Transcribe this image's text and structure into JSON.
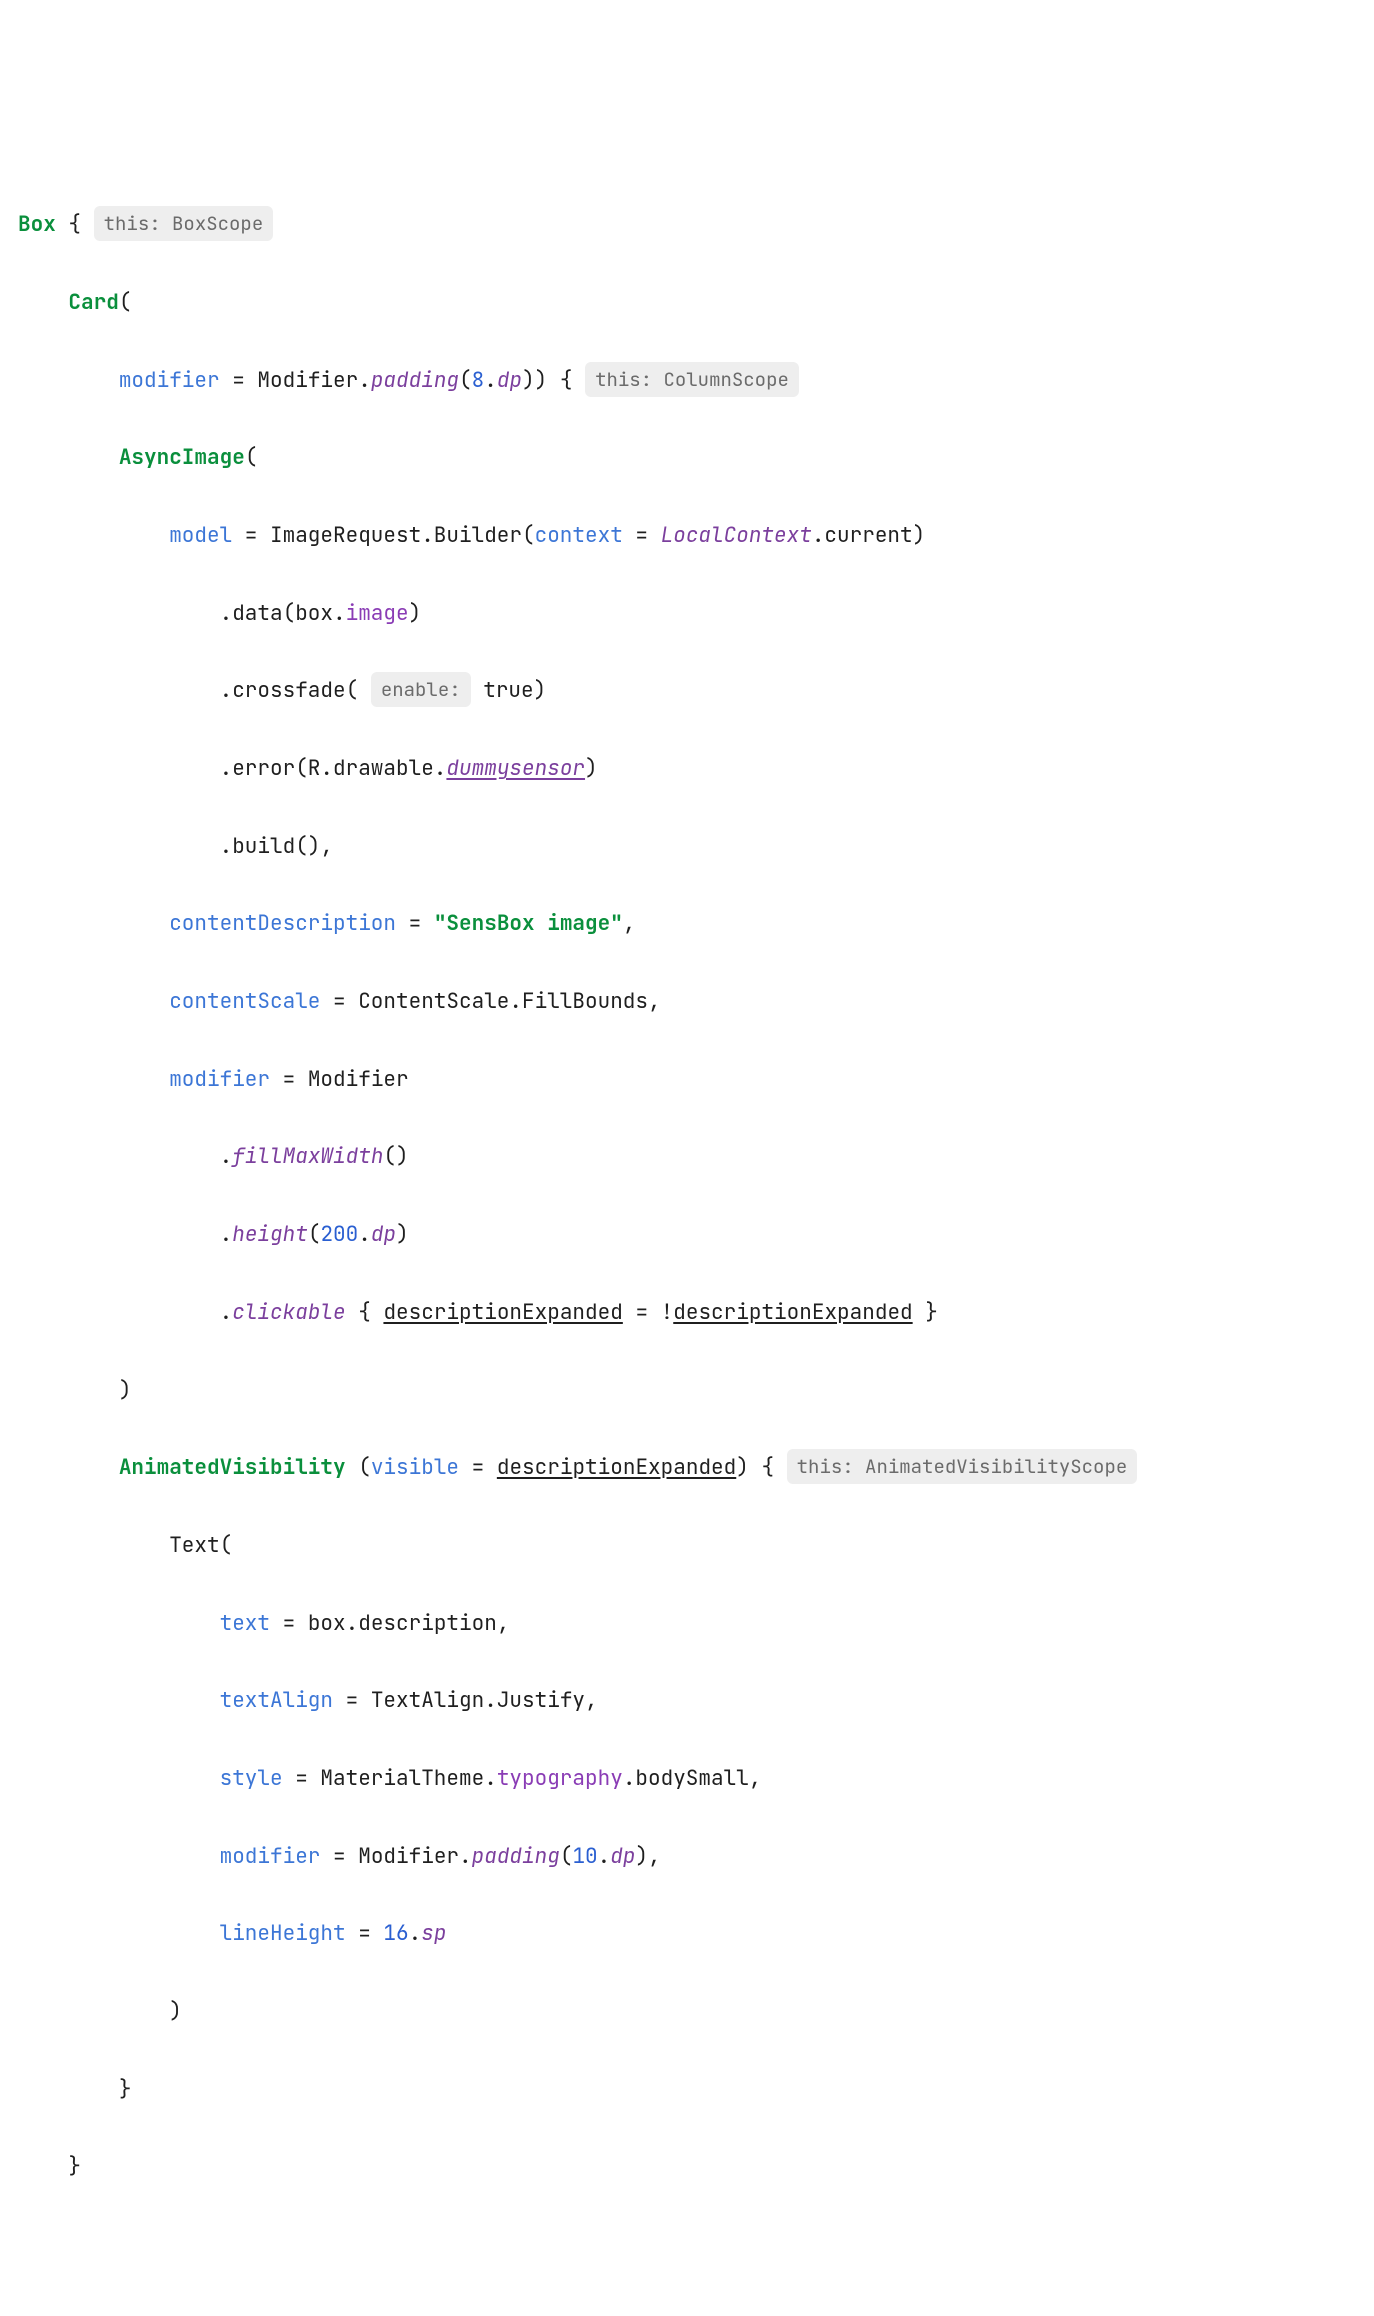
{
  "code": {
    "l1_box": "Box",
    "l1_brace": " { ",
    "hint_box": "this: BoxScope",
    "l2_indent": "    ",
    "l2_card": "Card",
    "l2_paren": "(",
    "l3_indent": "        ",
    "l3_modifier": "modifier",
    "l3_eq": " = Modifier.",
    "l3_padding": "padding",
    "l3_open": "(",
    "l3_num": "8",
    "l3_dot": ".",
    "l3_dp": "dp",
    "l3_close": ")) { ",
    "hint_card": "this: ColumnScope",
    "l4_indent": "        ",
    "l4_async": "AsyncImage",
    "l4_paren": "(",
    "l5_indent": "            ",
    "l5_model": "model",
    "l5_eq": " = ImageRequest.Builder(",
    "l5_context": "context",
    "l5_eq2": " = ",
    "l5_local": "LocalContext",
    "l5_current": ".current)",
    "l6_indent": "                ",
    "l6_data": ".data(box.",
    "l6_image": "image",
    "l6_close": ")",
    "l7_indent": "                ",
    "l7_cross": ".crossfade( ",
    "hint_enable": "enable:",
    "l7_true": " true",
    "l7_close": ")",
    "l8_indent": "                ",
    "l8_err": ".error(R.drawable.",
    "l8_dummy": "dummysensor",
    "l8_close": ")",
    "l9_indent": "                ",
    "l9_build": ".build(),",
    "l10_indent": "            ",
    "l10_cd": "contentDescription",
    "l10_eq": " = ",
    "l10_str": "\"SensBox image\"",
    "l10_comma": ",",
    "l11_indent": "            ",
    "l11_cs": "contentScale",
    "l11_eq": " = ContentScale.FillBounds,",
    "l12_indent": "            ",
    "l12_mod": "modifier",
    "l12_eq": " = Modifier",
    "l13_indent": "                ",
    "l13_dot": ".",
    "l13_fill": "fillMaxWidth",
    "l13_close": "()",
    "l14_indent": "                ",
    "l14_dot": ".",
    "l14_height": "height",
    "l14_open": "(",
    "l14_num": "200",
    "l14_dot2": ".",
    "l14_dp": "dp",
    "l14_close": ")",
    "l15_indent": "                ",
    "l15_dot": ".",
    "l15_click": "clickable",
    "l15_sp": " { ",
    "l15_de1": "descriptionExpanded",
    "l15_eq": " = !",
    "l15_de2": "descriptionExpanded",
    "l15_close": " }",
    "l16_indent": "        ",
    "l16_close": ")",
    "l17_indent": "        ",
    "l17_anim": "AnimatedVisibility",
    "l17_sp": " (",
    "l17_vis": "visible",
    "l17_eq": " = ",
    "l17_de": "descriptionExpanded",
    "l17_close": ") { ",
    "hint_anim": "this: AnimatedVisibilityScope",
    "l18_indent": "            ",
    "l18_text": "Text(",
    "l19_indent": "                ",
    "l19_text": "text",
    "l19_eq": " = box.description,",
    "l20_indent": "                ",
    "l20_ta": "textAlign",
    "l20_eq": " = TextAlign.Justify,",
    "l21_indent": "                ",
    "l21_style": "style",
    "l21_eq": " = MaterialTheme.",
    "l21_typo": "typography",
    "l21_body": ".bodySmall,",
    "l22_indent": "                ",
    "l22_mod": "modifier",
    "l22_eq": " = Modifier.",
    "l22_pad": "padding",
    "l22_open": "(",
    "l22_num": "10",
    "l22_dot": ".",
    "l22_dp": "dp",
    "l22_close": "),",
    "l23_indent": "                ",
    "l23_lh": "lineHeight",
    "l23_eq": " = ",
    "l23_num": "16",
    "l23_dot": ".",
    "l23_sp": "sp",
    "l24_indent": "            ",
    "l24_close": ")",
    "l25_indent": "        ",
    "l25_close": "}",
    "l26_indent": "    ",
    "l26_close": "}"
  }
}
